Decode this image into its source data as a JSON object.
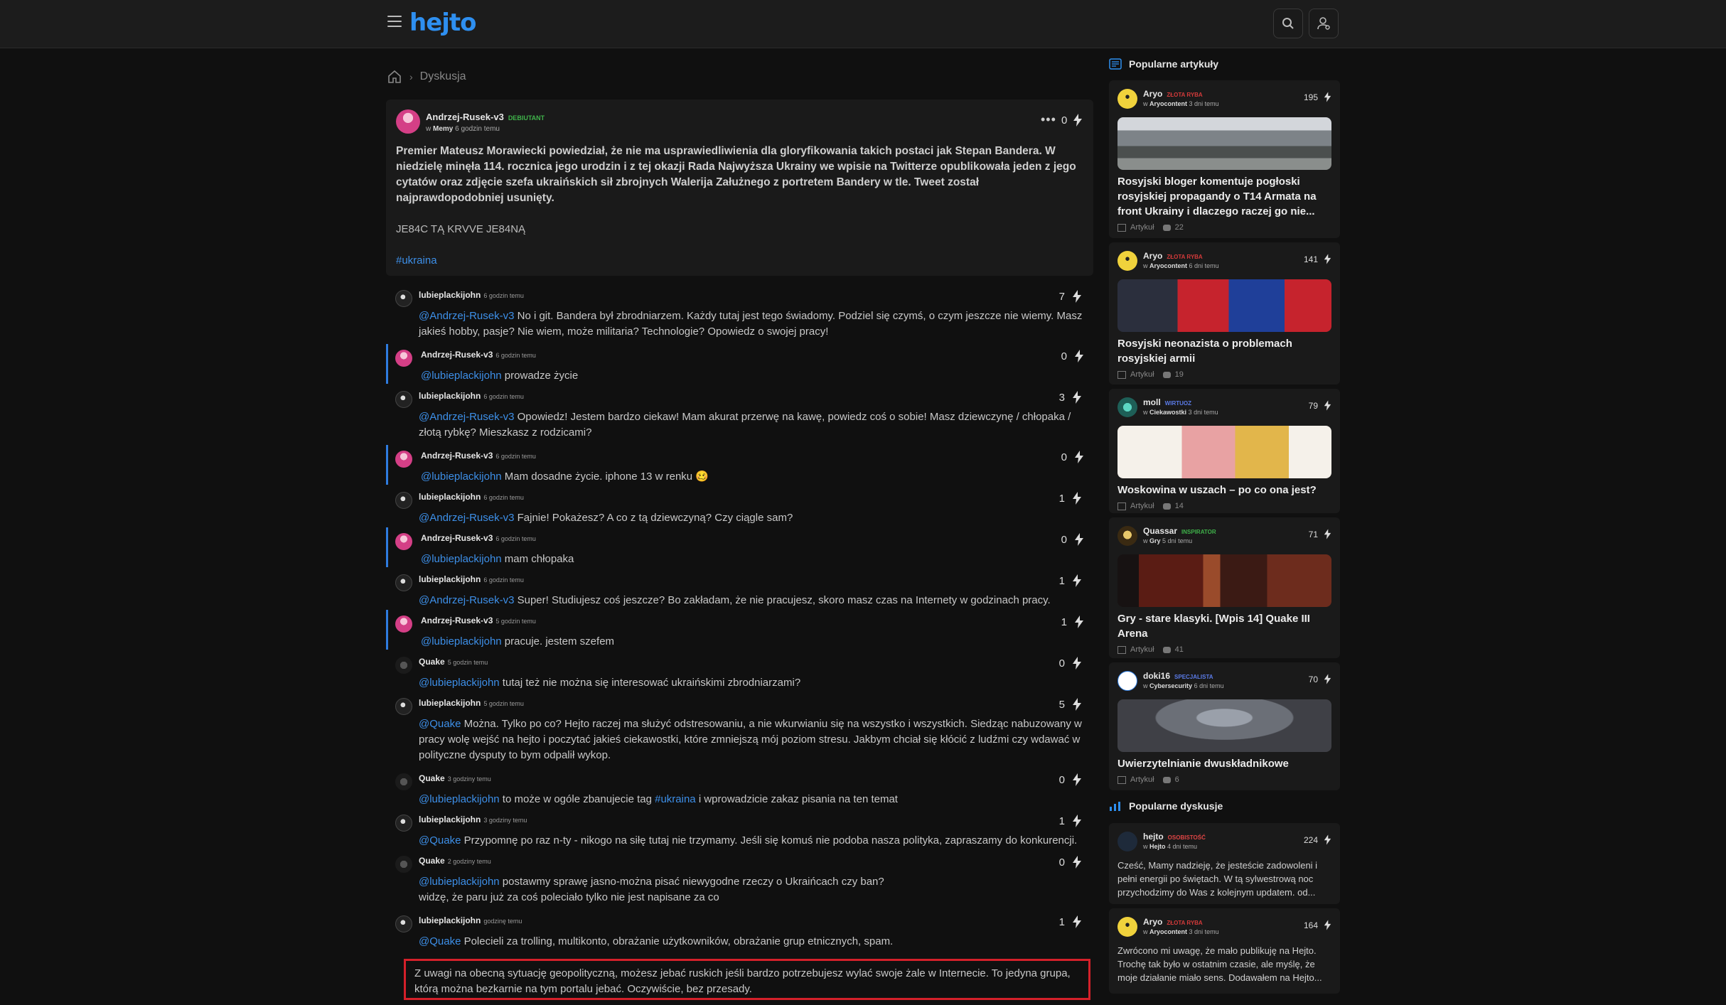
{
  "header": {
    "logo": "hejto"
  },
  "breadcrumb": {
    "current": "Dyskusja"
  },
  "post": {
    "author": "Andrzej-Rusek-v3",
    "rank": "DEBIUTANT",
    "in": "w",
    "community": "Memy",
    "time": "6 godzin temu",
    "votes": "0",
    "body": "Premier Mateusz Morawiecki powiedział, że nie ma usprawiedliwienia dla gloryfikowania takich postaci jak Stepan Bandera. W niedzielę minęła 114. rocznica jego urodzin i z tej okazji Rada Najwyższa Ukrainy we wpisie na Twitterze opublikowała jeden z jego cytatów oraz zdjęcie szefa ukraińskich sił zbrojnych Walerija Załużnego z portretem Bandery w tle. Tweet został najprawdopodobniej usunięty.",
    "extra": "JE84C TĄ KRVVE JE84NĄ",
    "tag": "#ukraina",
    "colors": {
      "rank": "#3fb24a",
      "link": "#3d8fe8"
    }
  },
  "comments": [
    {
      "author": "lubieplackijohn",
      "time": "6 godzin temu",
      "votes": "7",
      "mention": "@Andrzej-Rusek-v3",
      "text": " No i git. Bandera był zbrodniarzem. Każdy tutaj jest tego świadomy. Podziel się czymś, o czym jeszcze nie wiemy. Masz jakieś hobby, pasje? Nie wiem, może militaria? Technologie? Opowiedz o swojej pracy!"
    },
    {
      "author": "Andrzej-Rusek-v3",
      "time": "6 godzin temu",
      "votes": "0",
      "mention": "@lubieplackijohn",
      "text": " prowadze życie"
    },
    {
      "author": "lubieplackijohn",
      "time": "6 godzin temu",
      "votes": "3",
      "mention": "@Andrzej-Rusek-v3",
      "text": " Opowiedz! Jestem bardzo ciekaw! Mam akurat przerwę na kawę, powiedz coś o sobie! Masz dziewczynę / chłopaka / złotą rybkę? Mieszkasz z rodzicami?"
    },
    {
      "author": "Andrzej-Rusek-v3",
      "time": "6 godzin temu",
      "votes": "0",
      "mention": "@lubieplackijohn",
      "text": " Mam dosadne życie. iphone 13 w renku 🥴"
    },
    {
      "author": "lubieplackijohn",
      "time": "6 godzin temu",
      "votes": "1",
      "mention": "@Andrzej-Rusek-v3",
      "text": " Fajnie! Pokażesz? A co z tą dziewczyną? Czy ciągle sam?"
    },
    {
      "author": "Andrzej-Rusek-v3",
      "time": "6 godzin temu",
      "votes": "0",
      "mention": "@lubieplackijohn",
      "text": " mam chłopaka"
    },
    {
      "author": "lubieplackijohn",
      "time": "6 godzin temu",
      "votes": "1",
      "mention": "@Andrzej-Rusek-v3",
      "text": " Super! Studiujesz coś jeszcze? Bo zakładam, że nie pracujesz, skoro masz czas na Internety w godzinach pracy."
    },
    {
      "author": "Andrzej-Rusek-v3",
      "time": "5 godzin temu",
      "votes": "1",
      "mention": "@lubieplackijohn",
      "text": " pracuje. jestem szefem"
    },
    {
      "author": "Quake",
      "time": "5 godzin temu",
      "votes": "0",
      "mention": "@lubieplackijohn",
      "text": " tutaj też nie można się interesować ukraińskimi zbrodniarzami?"
    },
    {
      "author": "lubieplackijohn",
      "time": "5 godzin temu",
      "votes": "5",
      "mention": "@Quake",
      "text": " Można. Tylko po co? Hejto raczej ma służyć odstresowaniu, a nie wkurwianiu się na wszystko i wszystkich. Siedząc nabuzowany w pracy wolę wejść na hejto i poczytać jakieś ciekawostki, które zmniejszą mój poziom stresu. Jakbym chciał się kłócić z ludźmi czy wdawać w polityczne dysputy to bym odpalił wykop."
    },
    {
      "author": "Quake",
      "time": "3 godziny temu",
      "votes": "0",
      "mention": "@lubieplackijohn",
      "text": " to może w ogóle zbanujecie tag ",
      "tag": "#ukraina",
      "text2": " i wprowadzicie zakaz pisania na ten temat"
    },
    {
      "author": "lubieplackijohn",
      "time": "3 godziny temu",
      "votes": "1",
      "mention": "@Quake",
      "text": " Przypomnę po raz n-ty - nikogo na siłę tutaj nie trzymamy. Jeśli się komuś nie podoba nasza polityka, zapraszamy do konkurencji."
    },
    {
      "author": "Quake",
      "time": "2 godziny temu",
      "votes": "0",
      "mention": "@lubieplackijohn",
      "text": " postawmy sprawę jasno-można pisać niewygodne rzeczy o Ukraińcach czy ban?",
      "line2": "widzę, że paru już za coś poleciało tylko nie jest napisane za co"
    },
    {
      "author": "lubieplackijohn",
      "time": "godzinę temu",
      "votes": "1",
      "mention": "@Quake",
      "text": " Polecieli za trolling, multikonto, obrażanie użytkowników, obrażanie grup etnicznych, spam."
    }
  ],
  "highlight": "Z uwagi na obecną sytuację geopolityczną, możesz jebać ruskich jeśli bardzo potrzebujesz wylać swoje żale w Internecie. To jedyna grupa, którą można bezkarnie na tym portalu jebać. Oczywiście, bez przesady.",
  "sidebar": {
    "popular_articles_title": "Popularne artykuły",
    "popular_discussions_title": "Popularne dyskusje",
    "article_label": "Artykuł",
    "articles": [
      {
        "author": "Aryo",
        "rank": "ZŁOTA RYBA",
        "in": "w",
        "community": "Aryocontent",
        "time": "3 dni temu",
        "votes": "195",
        "title": "Rosyjski bloger komentuje pogłoski rosyjskiej propagandy o T14 Armata na front Ukrainy i dlaczego raczej go nie...",
        "comments": "22"
      },
      {
        "author": "Aryo",
        "rank": "ZŁOTA RYBA",
        "in": "w",
        "community": "Aryocontent",
        "time": "6 dni temu",
        "votes": "141",
        "title": "Rosyjski neonazista o problemach rosyjskiej armii",
        "comments": "19"
      },
      {
        "author": "moll",
        "rank": "WIRTUOZ",
        "in": "w",
        "community": "Ciekawostki",
        "time": "3 dni temu",
        "votes": "79",
        "title": "Woskowina w uszach – po co ona jest?",
        "comments": "14"
      },
      {
        "author": "Quassar",
        "rank": "INSPIRATOR",
        "in": "w",
        "community": "Gry",
        "time": "5 dni temu",
        "votes": "71",
        "title": "Gry - stare klasyki. [Wpis 14] Quake III Arena",
        "comments": "41"
      },
      {
        "author": "doki16",
        "rank": "SPECJALISTA",
        "in": "w",
        "community": "Cybersecurity",
        "time": "6 dni temu",
        "votes": "70",
        "title": "Uwierzytelnianie dwuskładnikowe",
        "comments": "6"
      }
    ],
    "discussions": [
      {
        "author": "hejto",
        "rank": "OSOBISTOŚĆ",
        "in": "w",
        "community": "Hejto",
        "time": "4 dni temu",
        "votes": "224",
        "excerpt": "Cześć, Mamy nadzieję, że jesteście zadowoleni i pełni energii po świętach. W tą sylwestrową noc przychodzimy do Was z kolejnym updatem. od..."
      },
      {
        "author": "Aryo",
        "rank": "ZŁOTA RYBA",
        "in": "w",
        "community": "Aryocontent",
        "time": "3 dni temu",
        "votes": "164",
        "excerpt": "Zwrócono mi uwagę, że mało publikuję na Hejto. Trochę tak było w ostatnim czasie, ale myślę, że moje działanie miało sens. Dodawałem na Hejto..."
      }
    ],
    "colors": {
      "gold": "#d33a3a",
      "virtuoso": "#5b7be8",
      "inspirator": "#3fb24a",
      "specialist": "#5b7be8",
      "personality": "#e04545"
    }
  }
}
